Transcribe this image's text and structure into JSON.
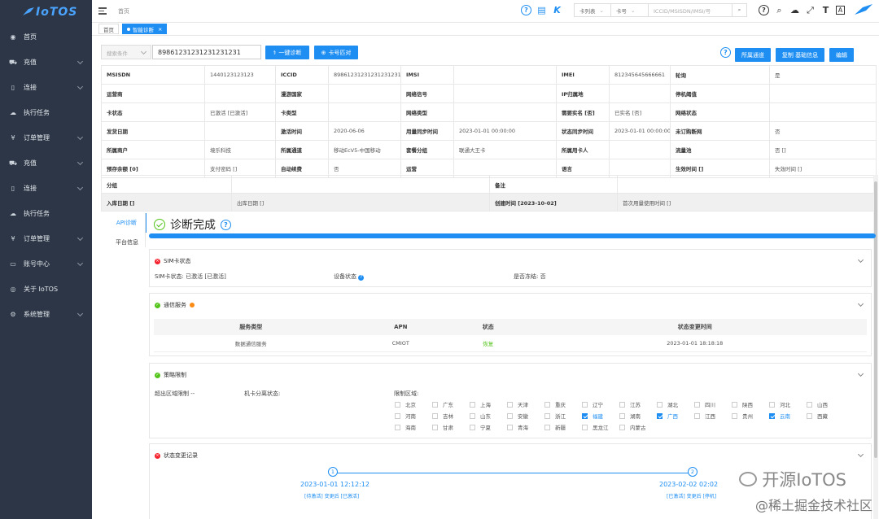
{
  "sidebar": {
    "logo": "IoTOS",
    "items": [
      {
        "label": "首页",
        "icon": "dashboard-icon",
        "chev": false
      },
      {
        "label": "充值",
        "icon": "cart-icon",
        "chev": true
      },
      {
        "label": "连接",
        "icon": "sim-icon",
        "chev": true
      },
      {
        "label": "执行任务",
        "icon": "cloud-icon",
        "chev": false
      },
      {
        "label": "订单管理",
        "icon": "yen-icon",
        "chev": true
      },
      {
        "label": "充值",
        "icon": "cart-icon",
        "chev": true
      },
      {
        "label": "连接",
        "icon": "sim-icon",
        "chev": true
      },
      {
        "label": "执行任务",
        "icon": "cloud-icon",
        "chev": false
      },
      {
        "label": "订单管理",
        "icon": "yen-icon",
        "chev": true
      },
      {
        "label": "账号中心",
        "icon": "account-icon",
        "chev": true
      },
      {
        "label": "关于 IoTOS",
        "icon": "globe-icon",
        "chev": false
      },
      {
        "label": "系统管理",
        "icon": "gear-icon",
        "chev": true
      }
    ]
  },
  "topbar": {
    "breadcrumb": "首页",
    "card_type": "卡列表",
    "card_no": "卡号",
    "search_placeholder": "ICCID/MSISDN/IMSI/号",
    "text_size": "T",
    "translate": "A"
  },
  "tabs": [
    {
      "label": "首页",
      "active": false
    },
    {
      "label": "智能诊断",
      "active": true
    }
  ],
  "toolbar": {
    "select_placeholder": "搜索条件",
    "iccid_value": "89861231231231231231",
    "one_key_btn": "一键诊断",
    "card_match_btn": "卡号匹对",
    "channel_btn": "所属通道",
    "copy_btn": "复制 基础信息",
    "edit_btn": "编辑"
  },
  "info_rows": [
    [
      "MSISDN",
      "1440123123123",
      "ICCID",
      "89861231231231231231",
      "IMSI",
      "",
      "IMEI",
      "812345645666661",
      "轮询",
      "是"
    ],
    [
      "运营商",
      "",
      "漫游国家",
      "",
      "网络信号",
      "",
      "IP归属地",
      "",
      "停机阈值",
      ""
    ],
    [
      "卡状态",
      "已激活 [已激活]",
      "卡类型",
      "",
      "网络类型",
      "",
      "需要实名 [否]",
      "已实名 [否]",
      "网络状态",
      ""
    ],
    [
      "发货日期",
      "",
      "激活时间",
      "2020-06-06",
      "用量同步时间",
      "2023-01-01 00:00:00",
      "状态同步时间",
      "2023-01-01 00:00:00",
      "未订购断网",
      "否"
    ],
    [
      "所属商户",
      "境乐科技",
      "所属通道",
      "移动EcV5-中国移动",
      "套餐分组",
      "联通大王卡",
      "所属用卡人",
      "",
      "流量池",
      "否 []"
    ],
    [
      "预存余额 [0]",
      "支付密码 []",
      "自动续费",
      "否",
      "运营",
      "",
      "语言",
      "",
      "生效时间 []",
      "失效时间 []"
    ]
  ],
  "group_rows": [
    [
      "分组",
      "",
      "备注",
      ""
    ],
    [
      "入库日期 []",
      "出库日期 []",
      "创建时间 [2023-10-02]",
      "首次用量使用时间 []"
    ]
  ],
  "side_tabs": [
    {
      "label": "API诊断",
      "active": true
    },
    {
      "label": "平台信息",
      "active": false
    }
  ],
  "diagnosis": {
    "title": "诊断完成",
    "progress": 1.0
  },
  "sim_panel": {
    "title": "SIM卡状态",
    "sim_status": "SIM卡状态: 已激活 [已激活]",
    "device_status": "设备状态",
    "frozen": "是否冻结: 否"
  },
  "service_panel": {
    "title": "通信服务",
    "headers": [
      "服务类型",
      "APN",
      "状态",
      "状态变更时间"
    ],
    "rows": [
      [
        "数据通信服务",
        "CMIOT",
        "恢复",
        "2023-01-01 18:18:18"
      ]
    ]
  },
  "policy_panel": {
    "title": "策略限制",
    "over_region": "超出区域限制 --",
    "card_separation": "机卡分离状态:",
    "region_label": "限制区域:",
    "regions": [
      [
        "北京",
        "广东",
        "上海",
        "天津",
        "重庆",
        "辽宁",
        "江苏",
        "湖北",
        "四川",
        "陕西",
        "河北",
        "山西"
      ],
      [
        "河南",
        "吉林",
        "山东",
        "安徽",
        "浙江",
        "福建",
        "湖南",
        "广西",
        "江西",
        "贵州",
        "云南",
        "西藏"
      ],
      [
        "海南",
        "甘肃",
        "宁夏",
        "青海",
        "新疆",
        "黑龙江",
        "内蒙古"
      ]
    ],
    "checked": [
      "福建",
      "广西",
      "云南"
    ]
  },
  "status_panel": {
    "title": "状态变更记录",
    "events": [
      {
        "no": "1",
        "time": "2023-01-01 12:12:12",
        "desc": "[待激活] 变更后 [已激活]"
      },
      {
        "no": "2",
        "time": "2023-02-02 02:02",
        "desc": "[已激活] 变更后 [停机]"
      }
    ]
  },
  "watermark": {
    "line1": "开源IoTOS",
    "line2": "@稀土掘金技术社区"
  },
  "colors": {
    "primary": "#1e8ef2",
    "sidebar": "#2c3646",
    "success": "#52c41a",
    "danger": "#f5222d"
  }
}
